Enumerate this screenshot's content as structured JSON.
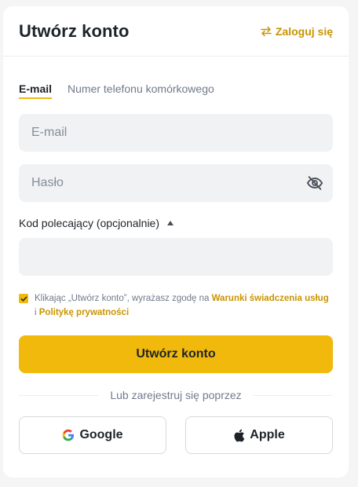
{
  "header": {
    "title": "Utwórz konto",
    "login_link_label": "Zaloguj się",
    "login_link_icon": "swap-arrows-icon"
  },
  "tabs": [
    {
      "label": "E-mail",
      "active": true
    },
    {
      "label": "Numer telefonu komórkowego",
      "active": false
    }
  ],
  "form": {
    "email_placeholder": "E-mail",
    "email_value": "",
    "password_placeholder": "Hasło",
    "password_value": "",
    "password_toggle_icon": "eye-off-icon",
    "referral_label": "Kod polecający (opcjonalnie)",
    "referral_toggle_icon": "caret-up-icon",
    "referral_value": "",
    "terms": {
      "checked": true,
      "text_before": "Klikając „Utwórz konto”, wyrażasz zgodę na ",
      "terms_link": "Warunki świadczenia usług",
      "conjunction": " i ",
      "privacy_link": "Politykę prywatności"
    },
    "submit_label": "Utwórz konto"
  },
  "divider_text": "Lub zarejestruj się poprzez",
  "social": {
    "google_label": "Google",
    "google_icon": "google-icon",
    "apple_label": "Apple",
    "apple_icon": "apple-icon"
  },
  "colors": {
    "accent": "#f0b90b",
    "link": "#c99400",
    "input_bg": "#f1f2f4",
    "text_primary": "#1e2329",
    "text_secondary": "#707a8a"
  }
}
